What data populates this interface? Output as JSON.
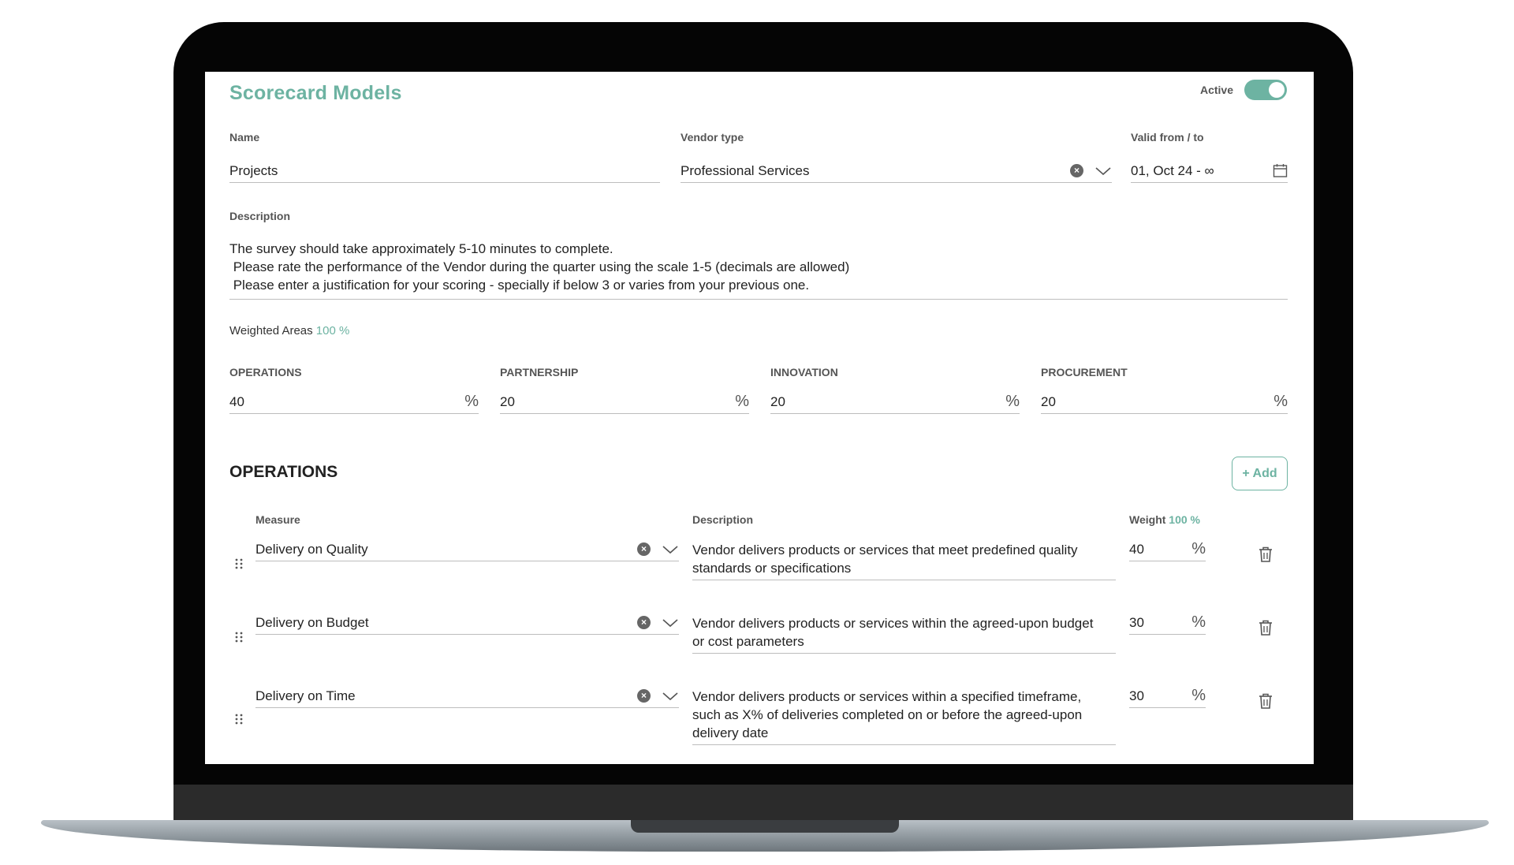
{
  "header": {
    "title": "Scorecard Models",
    "active_label": "Active",
    "active": true
  },
  "form": {
    "name_label": "Name",
    "name_value": "Projects",
    "vendor_type_label": "Vendor type",
    "vendor_type_value": "Professional Services",
    "valid_label": "Valid from / to",
    "valid_value": "01, Oct 24 - ∞",
    "description_label": "Description",
    "description_lines": [
      "The survey should take approximately 5-10 minutes to complete.",
      " Please rate the performance of the Vendor during the quarter using the scale 1-5 (decimals are allowed)",
      " Please enter a justification for your scoring - specially if below 3 or varies from your previous one."
    ]
  },
  "weighted": {
    "label": "Weighted Areas",
    "total": "100 %",
    "areas": [
      {
        "label": "OPERATIONS",
        "value": "40",
        "unit": "%"
      },
      {
        "label": "PARTNERSHIP",
        "value": "20",
        "unit": "%"
      },
      {
        "label": "INNOVATION",
        "value": "20",
        "unit": "%"
      },
      {
        "label": "PROCUREMENT",
        "value": "20",
        "unit": "%"
      }
    ]
  },
  "section": {
    "title": "OPERATIONS",
    "add_label": "+ Add",
    "col_measure": "Measure",
    "col_description": "Description",
    "col_weight": "Weight",
    "weight_total": "100 %",
    "rows": [
      {
        "measure": "Delivery on Quality",
        "description_lines": [
          "Vendor delivers products or services that meet predefined quality",
          "standards or specifications"
        ],
        "weight": "40",
        "unit": "%"
      },
      {
        "measure": "Delivery on Budget",
        "description_lines": [
          "Vendor delivers products or services within the agreed-upon budget",
          "or cost parameters"
        ],
        "weight": "30",
        "unit": "%"
      },
      {
        "measure": "Delivery on Time",
        "description_lines": [
          "Vendor delivers products or services within a specified timeframe,",
          "such as X% of deliveries completed on or before the agreed-upon",
          "delivery date"
        ],
        "weight": "30",
        "unit": "%"
      }
    ]
  },
  "colors": {
    "accent": "#6db3a2",
    "frame": "#050505"
  },
  "icons": [
    "clear-icon",
    "chevron-down-icon",
    "calendar-icon",
    "percent-icon",
    "drag-handle-icon",
    "trash-icon"
  ]
}
